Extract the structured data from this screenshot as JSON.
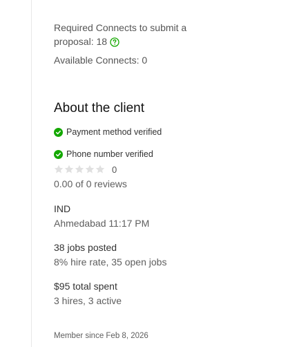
{
  "connects": {
    "required_text": "Required Connects to submit a proposal: 18",
    "available_text": "Available Connects: 0"
  },
  "client": {
    "section_title": "About the client",
    "payment_verified": "Payment method verified",
    "phone_verified": "Phone number verified",
    "rating": {
      "stars_filled": 0,
      "stars_total": 5,
      "count_label": "0",
      "reviews_text": "0.00 of 0 reviews"
    },
    "location": {
      "country": "IND",
      "city_time": "Ahmedabad 11:17 PM"
    },
    "jobs": {
      "posted": "38 jobs posted",
      "hire_rate": "8% hire rate, 35 open jobs"
    },
    "spending": {
      "total_spent": "$95 total spent",
      "hires": "3 hires, 3 active"
    },
    "member_since": "Member since Feb 8, 2026"
  },
  "colors": {
    "verified_green": "#14a800",
    "star_empty": "#e0e0e0",
    "text_dark": "#111111",
    "text_muted": "#5e5e5e"
  }
}
